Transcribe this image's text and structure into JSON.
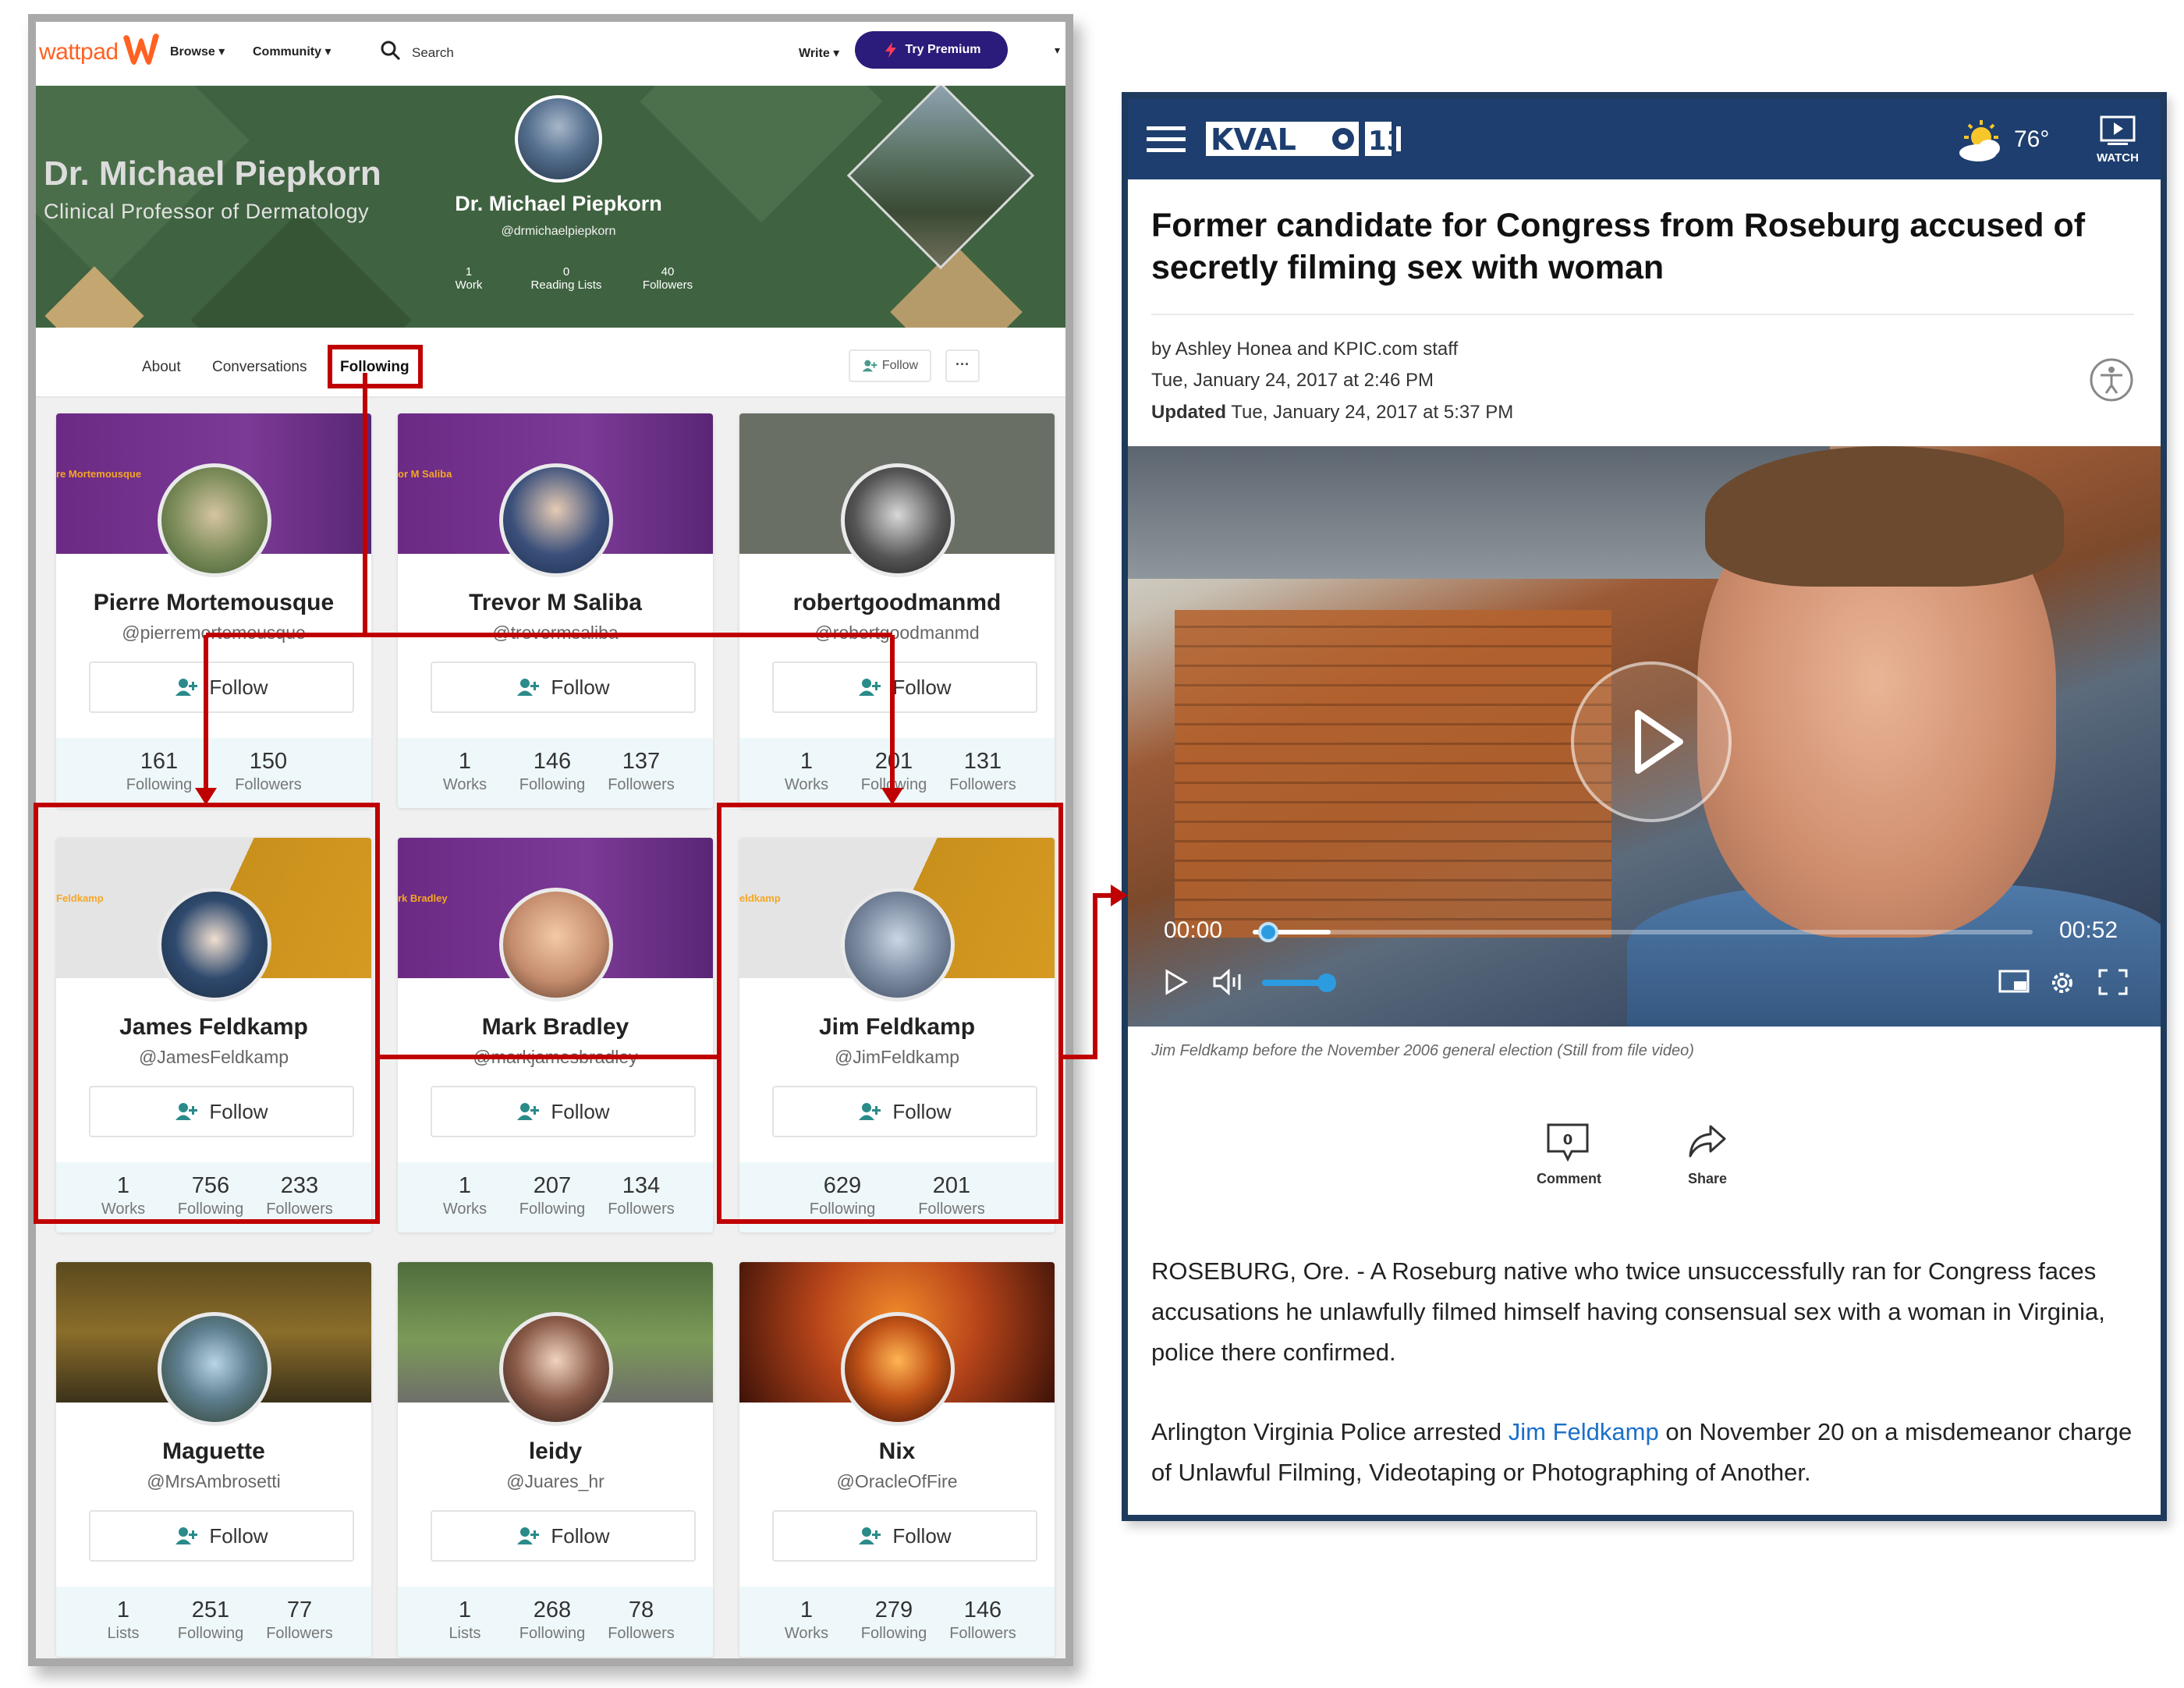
{
  "wattpad": {
    "logo_text": "wattpad",
    "nav": {
      "browse": "Browse",
      "community": "Community",
      "search": "Search",
      "write": "Write",
      "premium": "Try Premium"
    },
    "banner": {
      "name": "Dr. Michael Piepkorn",
      "subtitle": "Clinical Professor of Dermatology"
    },
    "profile": {
      "name": "Dr. Michael Piepkorn",
      "handle": "@drmichaelpiepkorn",
      "stats": [
        {
          "value": "1",
          "label": "Work"
        },
        {
          "value": "0",
          "label": "Reading Lists"
        },
        {
          "value": "40",
          "label": "Followers"
        }
      ]
    },
    "tabs": {
      "about": "About",
      "conversations": "Conversations",
      "following": "Following",
      "follow_button": "Follow",
      "more": "···"
    },
    "follow_label": "Follow",
    "cards": [
      {
        "name": "Pierre Mortemousque",
        "handle": "@pierremortemousque",
        "banner_text": "re Mortemousque",
        "stats": [
          {
            "value": "161",
            "label": "Following"
          },
          {
            "value": "150",
            "label": "Followers"
          }
        ]
      },
      {
        "name": "Trevor M Saliba",
        "handle": "@trevormsaliba",
        "banner_text": "or M Saliba",
        "stats": [
          {
            "value": "1",
            "label": "Works"
          },
          {
            "value": "146",
            "label": "Following"
          },
          {
            "value": "137",
            "label": "Followers"
          }
        ]
      },
      {
        "name": "robertgoodmanmd",
        "handle": "@robertgoodmanmd",
        "banner_text": "",
        "stats": [
          {
            "value": "1",
            "label": "Works"
          },
          {
            "value": "201",
            "label": "Following"
          },
          {
            "value": "131",
            "label": "Followers"
          }
        ]
      },
      {
        "name": "James Feldkamp",
        "handle": "@JamesFeldkamp",
        "banner_text": "Feldkamp",
        "stats": [
          {
            "value": "1",
            "label": "Works"
          },
          {
            "value": "756",
            "label": "Following"
          },
          {
            "value": "233",
            "label": "Followers"
          }
        ]
      },
      {
        "name": "Mark Bradley",
        "handle": "@markjamesbradley",
        "banner_text": "rk Bradley",
        "stats": [
          {
            "value": "1",
            "label": "Works"
          },
          {
            "value": "207",
            "label": "Following"
          },
          {
            "value": "134",
            "label": "Followers"
          }
        ]
      },
      {
        "name": "Jim Feldkamp",
        "handle": "@JimFeldkamp",
        "banner_text": "eldkamp",
        "stats": [
          {
            "value": "629",
            "label": "Following"
          },
          {
            "value": "201",
            "label": "Followers"
          }
        ]
      },
      {
        "name": "Maguette",
        "handle": "@MrsAmbrosetti",
        "banner_text": "",
        "stats": [
          {
            "value": "1",
            "label": "Lists"
          },
          {
            "value": "251",
            "label": "Following"
          },
          {
            "value": "77",
            "label": "Followers"
          }
        ]
      },
      {
        "name": "leidy",
        "handle": "@Juares_hr",
        "banner_text": "",
        "stats": [
          {
            "value": "1",
            "label": "Lists"
          },
          {
            "value": "268",
            "label": "Following"
          },
          {
            "value": "78",
            "label": "Followers"
          }
        ]
      },
      {
        "name": "Nix",
        "handle": "@OracleOfFire",
        "banner_text": "",
        "stats": [
          {
            "value": "1",
            "label": "Works"
          },
          {
            "value": "279",
            "label": "Following"
          },
          {
            "value": "146",
            "label": "Followers"
          }
        ]
      }
    ]
  },
  "kval": {
    "temperature": "76°",
    "watch_label": "WATCH",
    "headline": "Former candidate for Congress from Roseburg accused of secretly filming sex with woman",
    "byline": "by Ashley Honea and KPIC.com staff",
    "published": "Tue, January 24, 2017 at 2:46 PM",
    "updated_label": "Updated",
    "updated": "Tue, January 24, 2017 at 5:37 PM",
    "video": {
      "current_time": "00:00",
      "duration": "00:52",
      "progress": 0.02,
      "volume": 0.75
    },
    "caption": "Jim Feldkamp before the November 2006 general election (Still from file video)",
    "comment_count": "0",
    "comment_label": "Comment",
    "share_label": "Share",
    "paragraph1": "ROSEBURG, Ore. - A Roseburg native who twice unsuccessfully ran for Congress faces accusations he unlawfully filmed himself having consensual sex with a woman in Virginia, police there confirmed.",
    "paragraph2_pre": "Arlington Virginia Police arrested ",
    "paragraph2_link": "Jim Feldkamp",
    "paragraph2_post": " on November 20 on a misdemeanor charge of Unlawful Filming, Videotaping or Photographing of Another."
  },
  "colors": {
    "wattpad_orange": "#ff6122",
    "premium": "#2b1b7a",
    "banner_green": "#3f6240",
    "highlight_red": "#c00000",
    "kval_navy": "#1d3e6e",
    "player_blue": "#2d9be0"
  }
}
